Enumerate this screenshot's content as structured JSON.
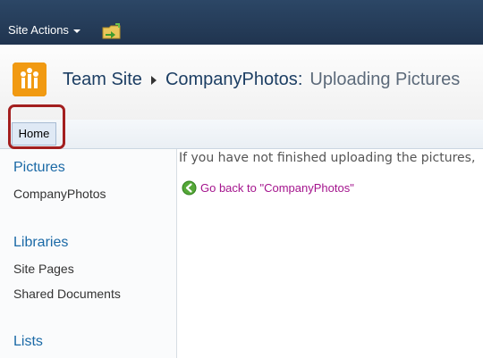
{
  "topbar": {
    "site_actions_label": "Site Actions",
    "icons": [
      "chevron-down-icon",
      "folder-navigate-icon"
    ]
  },
  "header": {
    "site_name": "Team Site",
    "list_name": "CompanyPhotos",
    "colon": ":",
    "page_title": "Uploading Pictures",
    "logo_icon": "team-site-logo-icon",
    "colors": {
      "logo": "#ec8b00",
      "link": "#1c3e63"
    }
  },
  "topnav": {
    "home_label": "Home",
    "highlight_color": "#a31f1f"
  },
  "leftnav": {
    "sections": [
      {
        "heading": "Pictures",
        "items": [
          "CompanyPhotos"
        ]
      },
      {
        "heading": "Libraries",
        "items": [
          "Site Pages",
          "Shared Documents"
        ]
      },
      {
        "heading": "Lists",
        "items": []
      }
    ]
  },
  "main": {
    "message": "If you have not finished uploading the pictures,",
    "goback_label": "Go back to \"CompanyPhotos\"",
    "goback_icon": "back-arrow-icon",
    "goback_color": "#a4148d"
  }
}
